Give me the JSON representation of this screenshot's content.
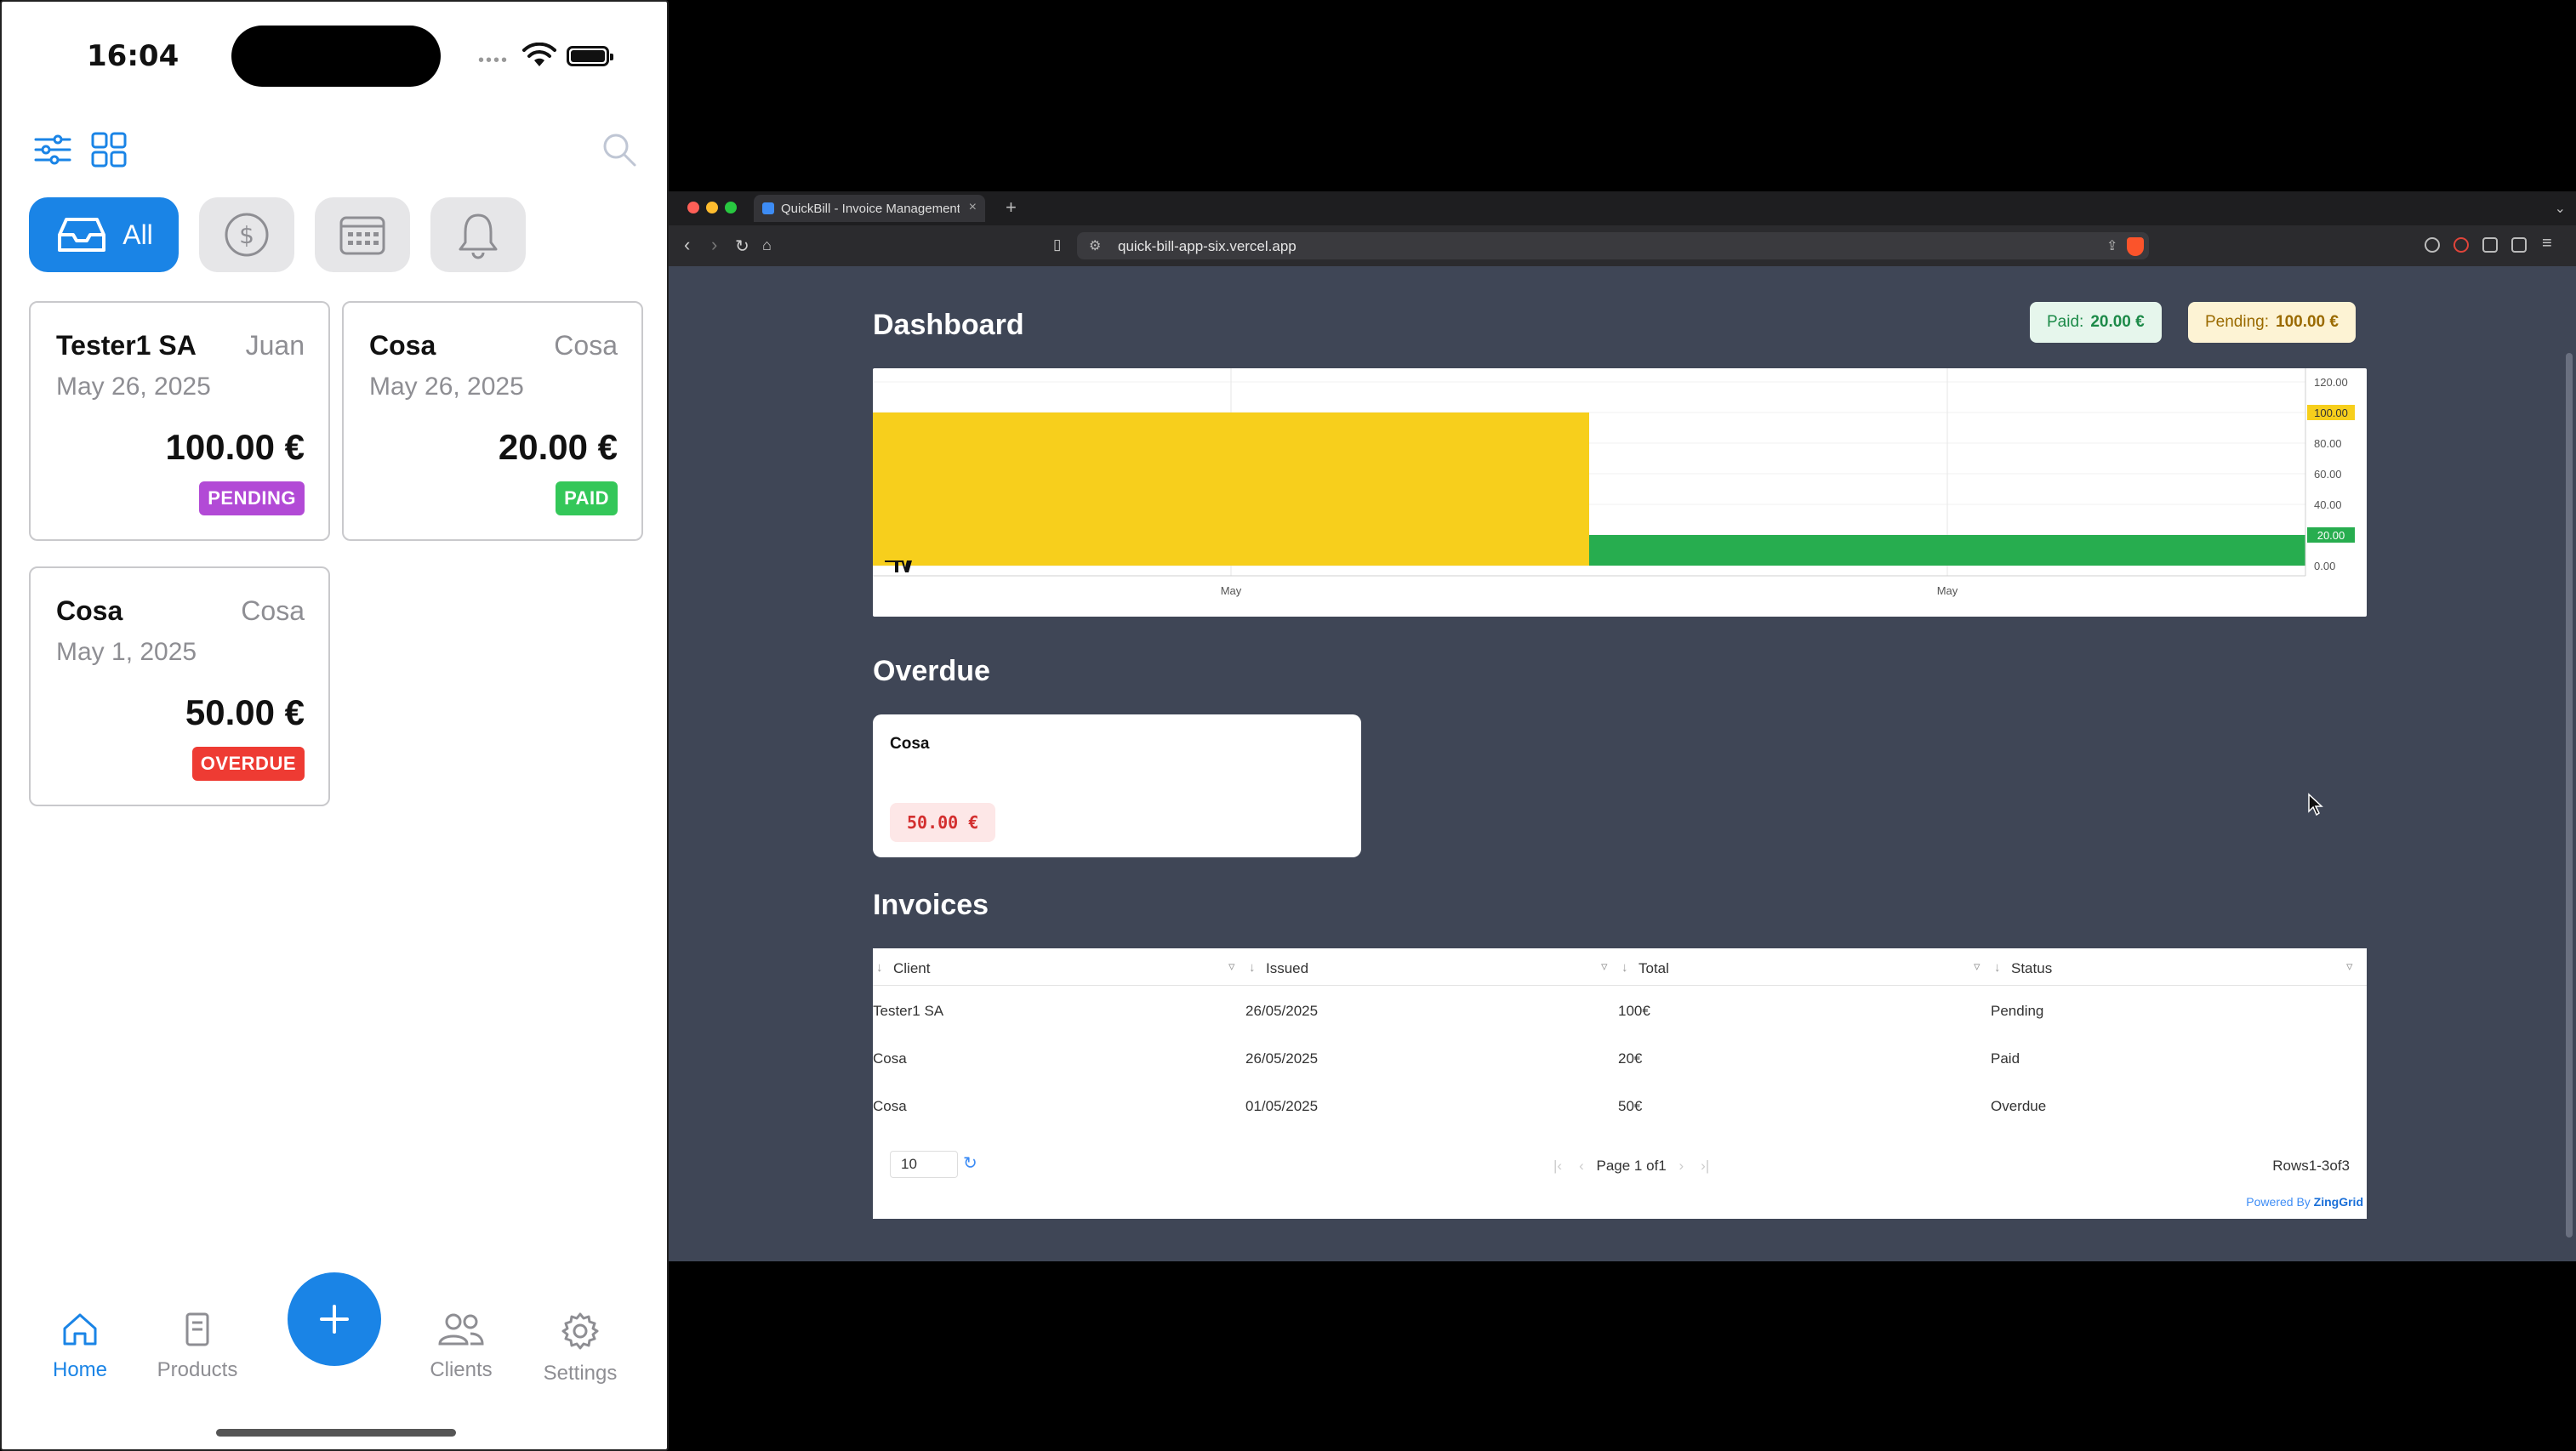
{
  "phone": {
    "status": {
      "time": "16:04"
    },
    "filters": {
      "all_label": "All"
    },
    "invoices": [
      {
        "client": "Tester1 SA",
        "contact": "Juan",
        "date": "May 26, 2025",
        "amount": "100.00 €",
        "status": "PENDING"
      },
      {
        "client": "Cosa",
        "contact": "Cosa",
        "date": "May 26, 2025",
        "amount": "20.00 €",
        "status": "PAID"
      },
      {
        "client": "Cosa",
        "contact": "Cosa",
        "date": "May 1, 2025",
        "amount": "50.00 €",
        "status": "OVERDUE"
      }
    ],
    "tabbar": {
      "home": "Home",
      "products": "Products",
      "clients": "Clients",
      "settings": "Settings"
    }
  },
  "browser": {
    "tab_title": "QuickBill - Invoice Management",
    "url": "quick-bill-app-six.vercel.app",
    "page": {
      "dashboard_title": "Dashboard",
      "paid_pill": {
        "key": "Paid:",
        "value": "20.00 €"
      },
      "pending_pill": {
        "key": "Pending:",
        "value": "100.00 €"
      },
      "overdue_title": "Overdue",
      "overdue_card": {
        "client": "Cosa",
        "amount": "50.00 €"
      },
      "invoices_title": "Invoices",
      "grid": {
        "headers": [
          "Client",
          "Issued",
          "Total",
          "Status"
        ],
        "rows": [
          [
            "Tester1 SA",
            "26/05/2025",
            "100€",
            "Pending"
          ],
          [
            "Cosa",
            "26/05/2025",
            "20€",
            "Paid"
          ],
          [
            "Cosa",
            "01/05/2025",
            "50€",
            "Overdue"
          ]
        ],
        "page_size": "10",
        "pager": {
          "page_label": "Page",
          "page": "1",
          "of_label": "of1"
        },
        "rows_info": "Rows1-3of3",
        "powered_by": "Powered By",
        "powered_brand": "ZingGrid"
      }
    }
  },
  "chart_data": {
    "type": "bar",
    "categories": [
      "May",
      "May"
    ],
    "series": [
      {
        "values": [
          100,
          20
        ],
        "colors": [
          "#f7cf1c",
          "#27ad4f"
        ]
      }
    ],
    "ylim": [
      0,
      120
    ],
    "yticks": [
      "120.00",
      "100.00",
      "80.00",
      "60.00",
      "40.00",
      "20.00",
      "0.00"
    ],
    "markers": [
      "100.00",
      "20.00"
    ],
    "grid": true
  }
}
